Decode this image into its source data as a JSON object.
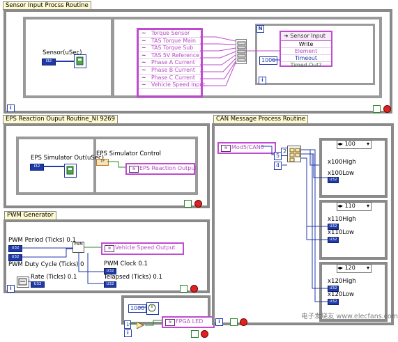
{
  "panels": {
    "sensor": {
      "title": "Sensor Input Procss Routine",
      "indicator_label": "Sensor(uSec)",
      "type_tag": "I32",
      "list_items": [
        "Torque Sensor",
        "TAS Torque Main",
        "TAS Torque Sub",
        "TAS 5V Reference",
        "Phase A Current",
        "Phase B Current",
        "Phase C Current",
        "Vehicle Speed Input"
      ],
      "property_node": {
        "header": "Sensor Input",
        "rows": [
          "Write",
          "Element",
          "Timeout",
          "Timed Out?"
        ]
      },
      "timeout_const": "1000",
      "iter_label": "i",
      "n_label": "N"
    },
    "eps": {
      "title": "EPS Reaction Ouput Routine_NI 9269",
      "indicator_label": "EPS Simulator Out(uSec)",
      "control_label": "EPS Simulator Control",
      "control_tag": "TF",
      "node_label": "EPS Reaction Output",
      "type_tag": "I32",
      "iter_label": "i"
    },
    "pwm": {
      "title": "PWM Generator",
      "labels": [
        "PWM Period (Ticks) 0.1",
        "PWM Duty Cycle (Ticks) 0",
        "Rate (Ticks) 0.1",
        "PWM Clock 0.1",
        "Telapsed (Ticks) 0.1"
      ],
      "node_label": "Vehicle Speed Output",
      "type_tag": "U32",
      "iter_label": "i",
      "pwm_block": "PWM"
    },
    "can": {
      "title": "CAN Message Process Routine",
      "node_label": "Mod5/CAN0",
      "consts": [
        "5",
        "2",
        "4"
      ],
      "cases": [
        {
          "selector": "100",
          "labels": [
            "x100High",
            "x100Low"
          ],
          "tag": "U32"
        },
        {
          "selector": "110",
          "labels": [
            "x110High",
            "x110Low"
          ],
          "tag": "U32"
        },
        {
          "selector": "120",
          "labels": [
            "x120High",
            "x120Low"
          ],
          "tag": "U32"
        }
      ],
      "iter_label": "i"
    },
    "led": {
      "const": "1000",
      "node_label": "FPGA LED",
      "iter_label": "i",
      "small_const": "1"
    }
  },
  "watermark": "电子发烧友 www.elecfans.com"
}
